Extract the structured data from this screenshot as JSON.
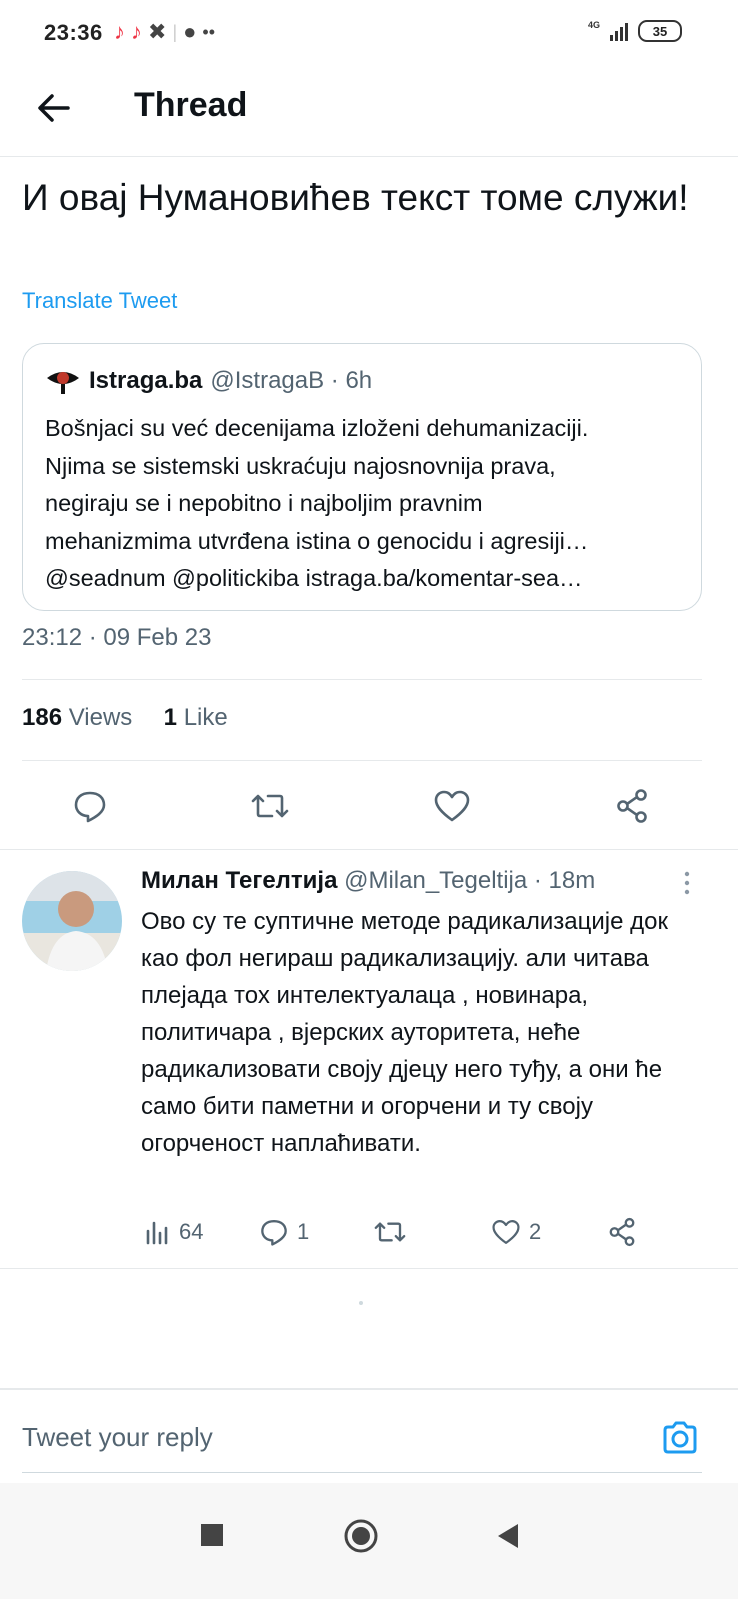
{
  "status_bar": {
    "time": "23:36",
    "app_icons": [
      "tiktok-icon",
      "tiktok-icon",
      "x-icon",
      "reddit-icon",
      "more-dots-icon"
    ],
    "network": "4G",
    "battery": "35"
  },
  "header": {
    "title": "Thread",
    "back_icon": "arrow-left-icon"
  },
  "tweet": {
    "text": "И овај Нумановићев текст томе служи!",
    "translate_label": "Translate Tweet",
    "timestamp": "23:12 · 09 Feb 23",
    "views_count": "186",
    "views_label": "Views",
    "likes_count": "1",
    "likes_label": "Like"
  },
  "quoted_tweet": {
    "name": "Istraga.ba",
    "handle": "@IstragaB · 6h",
    "text": "Bošnjaci su već decenijama izloženi dehumanizaciji.\nNjima se sistemski uskraćuju najosnovnija prava,\nnegiraju se i nepobitno i najboljim pravnim\nmehanizmima utvrđena istina o genocidu i agresiji…\n@seadnum @politickiba istraga.ba/komentar-sea…"
  },
  "reply": {
    "name": "Милан Тегелтија",
    "handle": "@Milan_Tegeltija · 18m",
    "text": "Ово су те суптичне методе радикализације док као фол негираш радикализацију. али читава плејада тох интелектуалаца , новинара, политичара , вјерских ауторитета, неће радикализовати своју дјецу него туђу, а они ће само бити паметни и огорчени и ту своју огорченост наплаћивати.",
    "views": "64",
    "replies": "1",
    "likes": "2"
  },
  "composer": {
    "placeholder": "Tweet your reply"
  },
  "colors": {
    "accent": "#1d9bf0",
    "text": "#0f1419",
    "secondary": "#536471",
    "border": "#e6e9eb"
  }
}
